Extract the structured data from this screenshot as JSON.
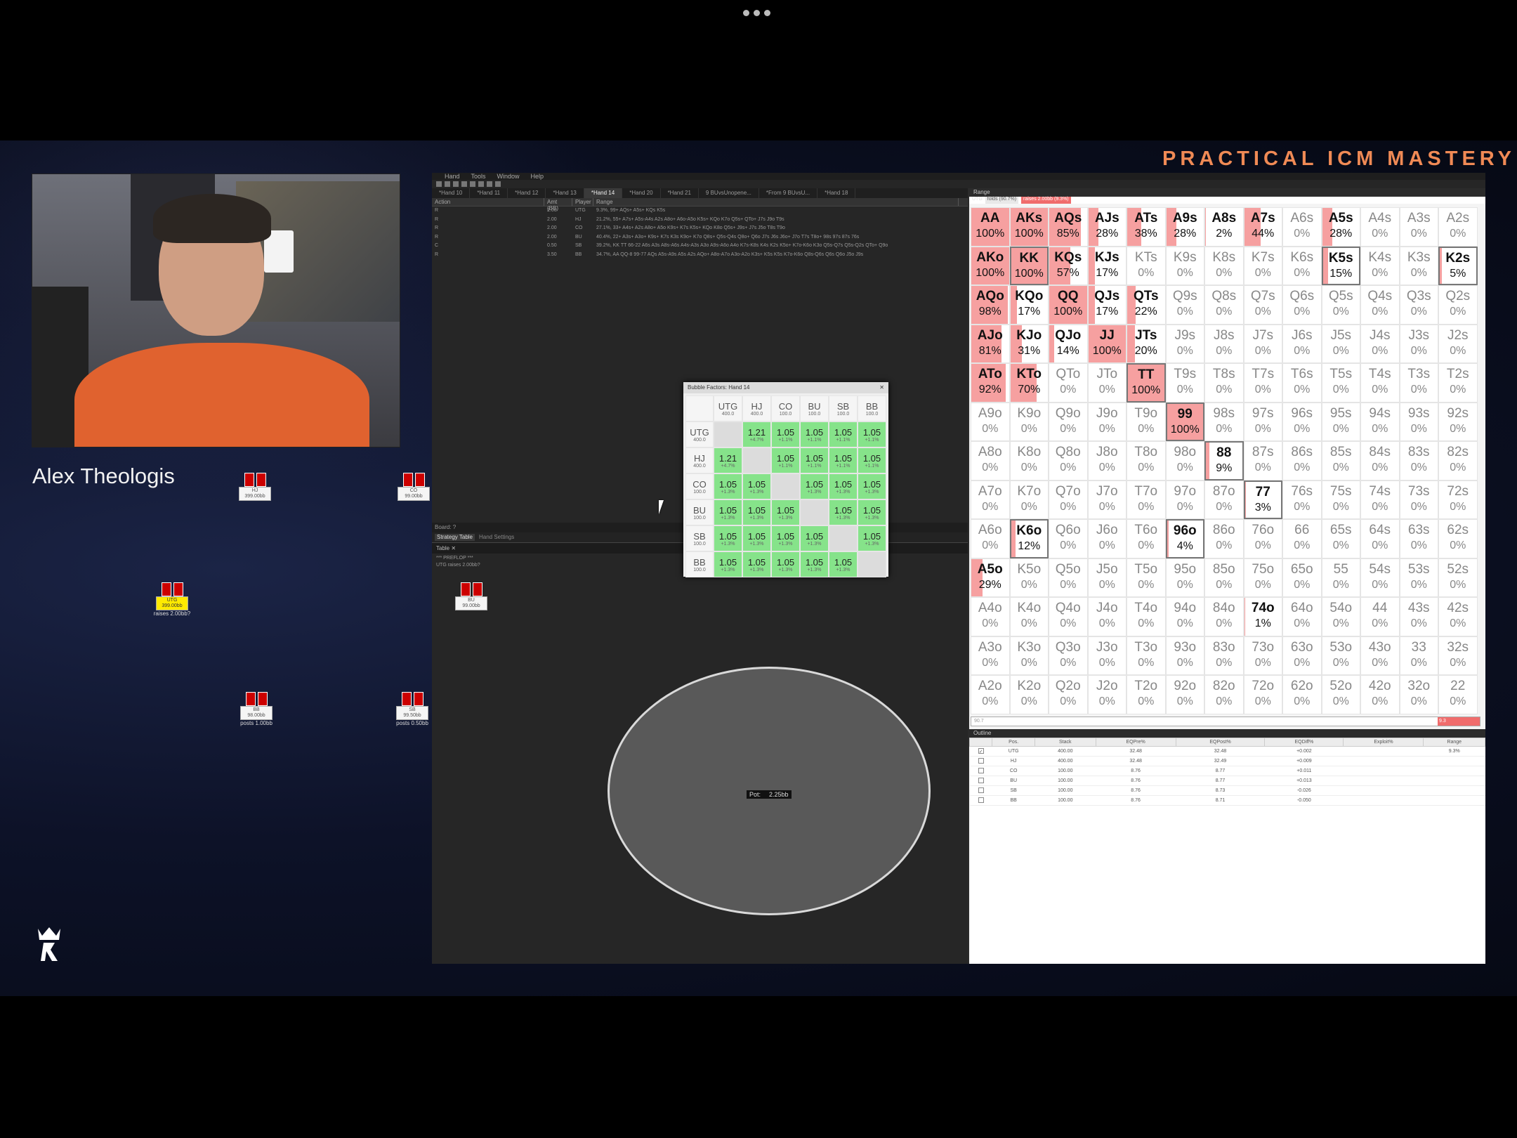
{
  "brand": "PRACTICAL ICM MASTERY",
  "presenter": "Alex Theologis",
  "app": {
    "menus": [
      "Hand",
      "Tools",
      "Window",
      "Help"
    ],
    "tabs": [
      "*Hand 10",
      "*Hand 11",
      "*Hand 12",
      "*Hand 13",
      "*Hand 14",
      "*Hand 20",
      "*Hand 21",
      "9 BUvsUnopene...",
      "*From 9 BUvsU...",
      "*Hand 18"
    ],
    "active_tab": "*Hand 14",
    "action_headers": [
      "Action",
      "Amt (BB)",
      "Player",
      "Range"
    ],
    "actions": [
      {
        "a": "R",
        "amt": "2.00",
        "p": "UTG",
        "r": "9.3%, 99+ AQs+ A5s+ KQs K5s"
      },
      {
        "a": "R",
        "amt": "2.00",
        "p": "HJ",
        "r": "21.2%, 55+ A7s+ A5s-A4s A2s A8o+ A6o-A5o K5s+ KQo K7o Q5s+ QTo+ J7s J9o T9s"
      },
      {
        "a": "R",
        "amt": "2.00",
        "p": "CO",
        "r": "27.1%, 33+ A4s+ A2s A8o+ A5o K9s+ K7s K5s+ KQo K8o Q5s+ J9s+ J7s J5o T8s T9o"
      },
      {
        "a": "R",
        "amt": "2.00",
        "p": "BU",
        "r": "40.4%, 22+ A3s+ A3o+ K9s+ K7s K3s K9o+ K7o Q8s+ Q5s-Q4s Q8o+ Q6o J7s J6s J6o+ J7o T7s T8o+ 98s 97s 87s 76s"
      },
      {
        "a": "C",
        "amt": "0.50",
        "p": "SB",
        "r": "39.2%, KK TT 66-22 A6s A3s A8s-A6s A4s-A3s A3o A9s-A6o A4o K7s-K8s K4s K2s K5o+ K7o-K6o K3o Q5s-Q7s Q5s-Q2s QTo+ Q9o"
      },
      {
        "a": "R",
        "amt": "3.50",
        "p": "BB",
        "r": "34.7%, AA QQ-8 99-77 AQs A5s-A9s A5s A2s AQo+ A8o-A7o A3o-A2o K3s+ K5s K5s K7o-K6o Q8s-Q6s Q6s Q6o J5o J9s"
      }
    ],
    "board_label": "Board: ?",
    "subtabs": [
      "Strategy Table",
      "Hand Settings"
    ],
    "table_tab": "Table",
    "log": [
      "*** PREFLOP ***",
      "UTG raises 2.00bb?"
    ],
    "pot_label": "Pot:",
    "pot_value": "2.25bb",
    "seats": [
      {
        "name": "HJ",
        "stack": "399.00bb",
        "note": ""
      },
      {
        "name": "CO",
        "stack": "99.00bb",
        "note": ""
      },
      {
        "name": "UTG",
        "stack": "399.00bb",
        "note": "raises 2.00bb?"
      },
      {
        "name": "BU",
        "stack": "99.00bb",
        "note": ""
      },
      {
        "name": "BB",
        "stack": "98.00bb",
        "note": "posts 1.00bb"
      },
      {
        "name": "SB",
        "stack": "99.50bb",
        "note": "posts 0.50bb"
      }
    ],
    "bubble": {
      "title": "Bubble Factors: Hand 14",
      "cols": [
        {
          "n": "UTG",
          "s": "400.0"
        },
        {
          "n": "HJ",
          "s": "400.0"
        },
        {
          "n": "CO",
          "s": "100.0"
        },
        {
          "n": "BU",
          "s": "100.0"
        },
        {
          "n": "SB",
          "s": "100.0"
        },
        {
          "n": "BB",
          "s": "100.0"
        }
      ],
      "rows": [
        [
          "",
          "1.21|+4.7%",
          "1.05|+1.1%",
          "1.05|+1.1%",
          "1.05|+1.1%",
          "1.05|+1.1%"
        ],
        [
          "1.21|+4.7%",
          "",
          "1.05|+1.1%",
          "1.05|+1.1%",
          "1.05|+1.1%",
          "1.05|+1.1%"
        ],
        [
          "1.05|+1.3%",
          "1.05|+1.3%",
          "",
          "1.05|+1.3%",
          "1.05|+1.3%",
          "1.05|+1.3%"
        ],
        [
          "1.05|+1.3%",
          "1.05|+1.3%",
          "1.05|+1.3%",
          "",
          "1.05|+1.3%",
          "1.05|+1.3%"
        ],
        [
          "1.05|+1.3%",
          "1.05|+1.3%",
          "1.05|+1.3%",
          "1.05|+1.3%",
          "",
          "1.05|+1.3%"
        ],
        [
          "1.05|+1.3%",
          "1.05|+1.3%",
          "1.05|+1.3%",
          "1.05|+1.3%",
          "1.05|+1.3%",
          ""
        ]
      ]
    },
    "range": {
      "title": "Range",
      "status_pos": "UTG",
      "status_fold": "folds (90.7%)",
      "status_raise": "raises 2.00bb (9.3%)",
      "bar_left": "90.7",
      "bar_right": "9.3",
      "grid": [
        [
          "AA|100",
          "AKs|100",
          "AQs|85",
          "AJs|28",
          "ATs|38",
          "A9s|28",
          "A8s|2",
          "A7s|44",
          "A6s|0",
          "A5s|28",
          "A4s|0",
          "A3s|0",
          "A2s|0"
        ],
        [
          "AKo|100",
          "KK|100",
          "KQs|57",
          "KJs|17",
          "KTs|0",
          "K9s|0",
          "K8s|0",
          "K7s|0",
          "K6s|0",
          "K5s|15",
          "K4s|0",
          "K3s|0",
          "K2s|5"
        ],
        [
          "AQo|98",
          "KQo|17",
          "QQ|100",
          "QJs|17",
          "QTs|22",
          "Q9s|0",
          "Q8s|0",
          "Q7s|0",
          "Q6s|0",
          "Q5s|0",
          "Q4s|0",
          "Q3s|0",
          "Q2s|0"
        ],
        [
          "AJo|81",
          "KJo|31",
          "QJo|14",
          "JJ|100",
          "JTs|20",
          "J9s|0",
          "J8s|0",
          "J7s|0",
          "J6s|0",
          "J5s|0",
          "J4s|0",
          "J3s|0",
          "J2s|0"
        ],
        [
          "ATo|92",
          "KTo|70",
          "QTo|0",
          "JTo|0",
          "TT|100",
          "T9s|0",
          "T8s|0",
          "T7s|0",
          "T6s|0",
          "T5s|0",
          "T4s|0",
          "T3s|0",
          "T2s|0"
        ],
        [
          "A9o|0",
          "K9o|0",
          "Q9o|0",
          "J9o|0",
          "T9o|0",
          "99|100",
          "98s|0",
          "97s|0",
          "96s|0",
          "95s|0",
          "94s|0",
          "93s|0",
          "92s|0"
        ],
        [
          "A8o|0",
          "K8o|0",
          "Q8o|0",
          "J8o|0",
          "T8o|0",
          "98o|0",
          "88|9",
          "87s|0",
          "86s|0",
          "85s|0",
          "84s|0",
          "83s|0",
          "82s|0"
        ],
        [
          "A7o|0",
          "K7o|0",
          "Q7o|0",
          "J7o|0",
          "T7o|0",
          "97o|0",
          "87o|0",
          "77|3",
          "76s|0",
          "75s|0",
          "74s|0",
          "73s|0",
          "72s|0"
        ],
        [
          "A6o|0",
          "K6o|12",
          "Q6o|0",
          "J6o|0",
          "T6o|0",
          "96o|4",
          "86o|0",
          "76o|0",
          "66|0",
          "65s|0",
          "64s|0",
          "63s|0",
          "62s|0"
        ],
        [
          "A5o|29",
          "K5o|0",
          "Q5o|0",
          "J5o|0",
          "T5o|0",
          "95o|0",
          "85o|0",
          "75o|0",
          "65o|0",
          "55|0",
          "54s|0",
          "53s|0",
          "52s|0"
        ],
        [
          "A4o|0",
          "K4o|0",
          "Q4o|0",
          "J4o|0",
          "T4o|0",
          "94o|0",
          "84o|0",
          "74o|1",
          "64o|0",
          "54o|0",
          "44|0",
          "43s|0",
          "42s|0"
        ],
        [
          "A3o|0",
          "K3o|0",
          "Q3o|0",
          "J3o|0",
          "T3o|0",
          "93o|0",
          "83o|0",
          "73o|0",
          "63o|0",
          "53o|0",
          "43o|0",
          "33|0",
          "32s|0"
        ],
        [
          "A2o|0",
          "K2o|0",
          "Q2o|0",
          "J2o|0",
          "T2o|0",
          "92o|0",
          "82o|0",
          "72o|0",
          "62o|0",
          "52o|0",
          "42o|0",
          "32o|0",
          "22|0"
        ]
      ]
    },
    "outline": {
      "title": "Outline",
      "headers": [
        "",
        "Pos.",
        "Stack",
        "EQPre%",
        "EQPost%",
        "EQDiff%",
        "Exploit%",
        "Range"
      ],
      "rows": [
        [
          "✓",
          "UTG",
          "400.00",
          "32.48",
          "32.48",
          "+0.002",
          "",
          "9.3%"
        ],
        [
          "",
          "HJ",
          "400.00",
          "32.48",
          "32.49",
          "+0.009",
          "",
          " "
        ],
        [
          "",
          "CO",
          "100.00",
          "8.76",
          "8.77",
          "+0.011",
          "",
          " "
        ],
        [
          "",
          "BU",
          "100.00",
          "8.76",
          "8.77",
          "+0.013",
          "",
          " "
        ],
        [
          "",
          "SB",
          "100.00",
          "8.76",
          "8.73",
          "-0.026",
          "",
          " "
        ],
        [
          "",
          "BB",
          "100.00",
          "8.76",
          "8.71",
          "-0.050",
          "",
          " "
        ]
      ]
    }
  }
}
